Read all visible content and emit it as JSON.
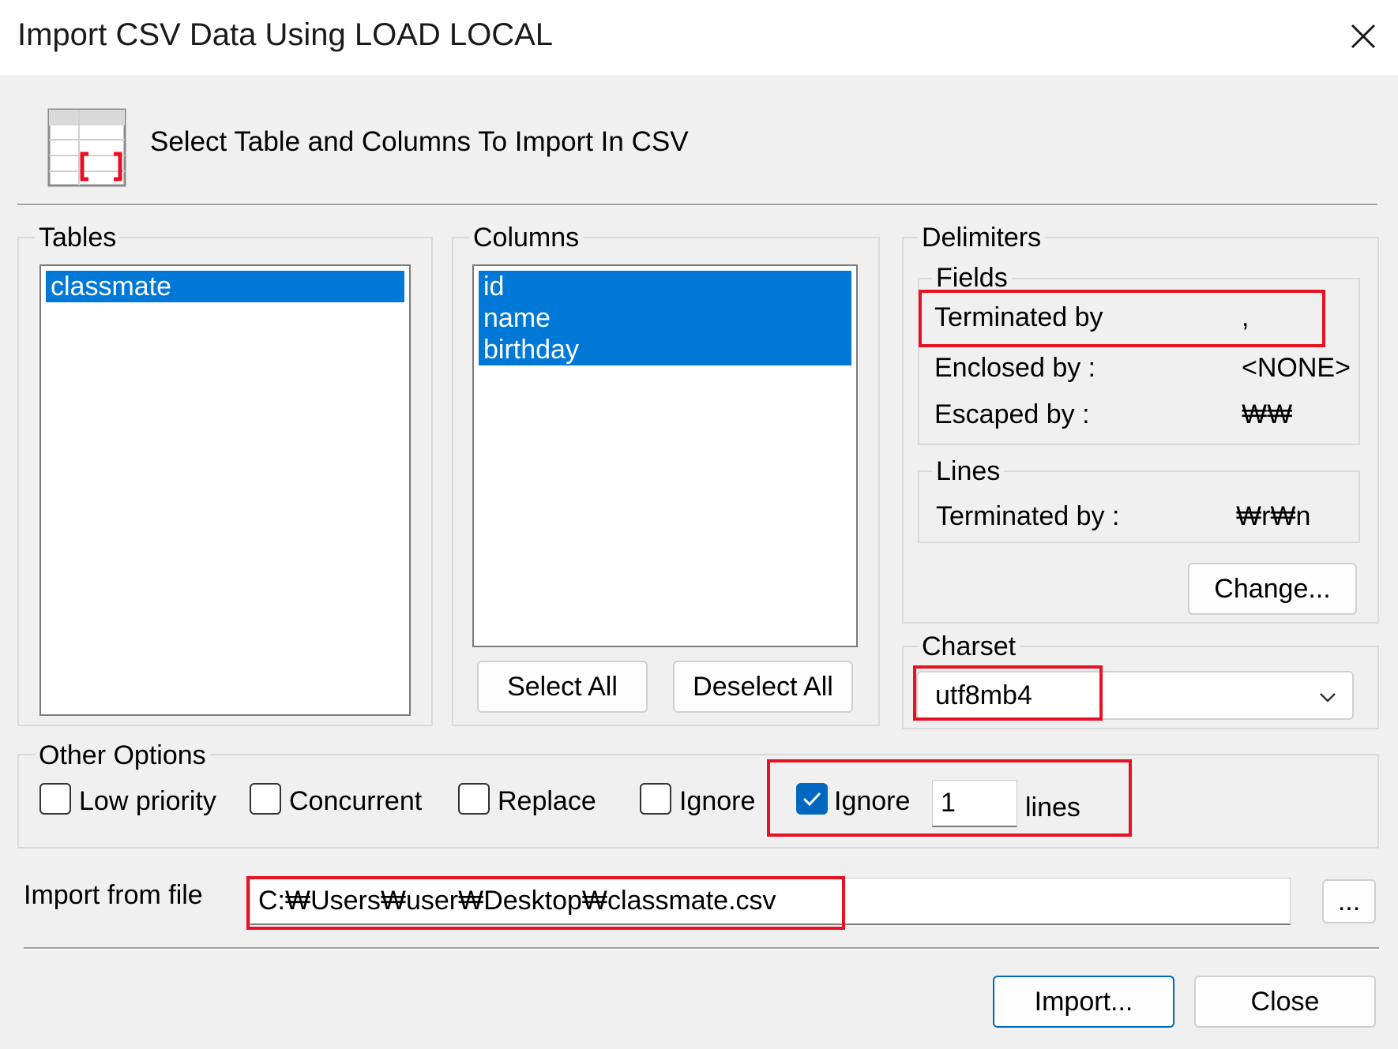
{
  "window": {
    "title": "Import CSV Data Using LOAD LOCAL"
  },
  "header": {
    "text": "Select Table and Columns To Import In CSV"
  },
  "tables": {
    "legend": "Tables",
    "items": [
      "classmate"
    ]
  },
  "columns": {
    "legend": "Columns",
    "items": [
      "id",
      "name",
      "birthday"
    ],
    "select_all": "Select All",
    "deselect_all": "Deselect All"
  },
  "delimiters": {
    "legend": "Delimiters",
    "fields": {
      "legend": "Fields",
      "terminated_label": "Terminated by",
      "terminated_value": ",",
      "enclosed_label": "Enclosed by :",
      "enclosed_value": "<NONE>",
      "escaped_label": "Escaped by :",
      "escaped_value": "₩₩"
    },
    "lines": {
      "legend": "Lines",
      "terminated_label": "Terminated by :",
      "terminated_value": "₩r₩n"
    },
    "change_button": "Change..."
  },
  "charset": {
    "legend": "Charset",
    "value": "utf8mb4"
  },
  "other_options": {
    "legend": "Other Options",
    "low_priority": "Low priority",
    "concurrent": "Concurrent",
    "replace": "Replace",
    "ignore": "Ignore",
    "ignore_lines_label": "Ignore",
    "ignore_lines_value": "1",
    "lines_suffix": "lines"
  },
  "import_file": {
    "label": "Import from file",
    "path": "C:₩Users₩user₩Desktop₩classmate.csv",
    "browse_label": "..."
  },
  "footer": {
    "import_button": "Import...",
    "close_button": "Close"
  },
  "colors": {
    "selection": "#0078d7",
    "highlight_box": "#e81123",
    "accent": "#0067c0"
  }
}
